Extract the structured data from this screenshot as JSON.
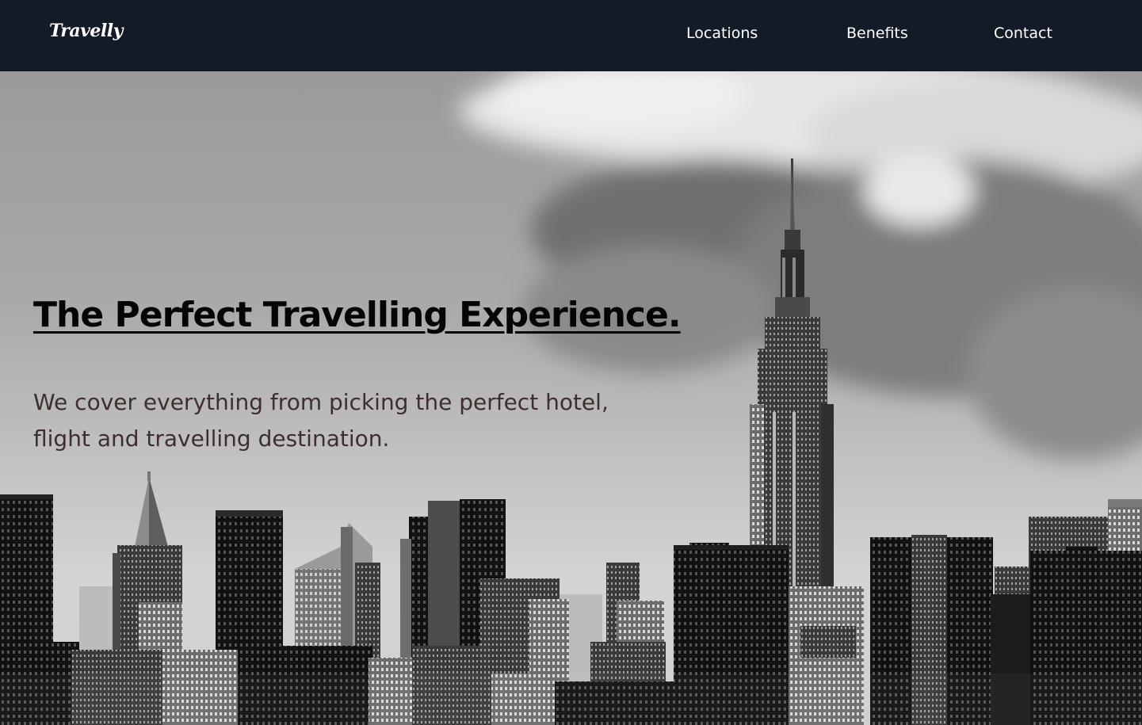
{
  "header": {
    "logo": "Travelly",
    "nav": [
      {
        "label": "Locations"
      },
      {
        "label": "Benefits"
      },
      {
        "label": "Contact"
      }
    ]
  },
  "hero": {
    "title": "The Perfect Travelling Experience.",
    "description": "We cover everything from picking the perfect hotel, flight and travelling destination.",
    "background": "black-and-white-city-skyline-photo"
  },
  "colors": {
    "navbar_bg": "#131b26",
    "nav_text": "#ffffff",
    "title_text": "#050505",
    "body_text": "#3f2e2e"
  }
}
